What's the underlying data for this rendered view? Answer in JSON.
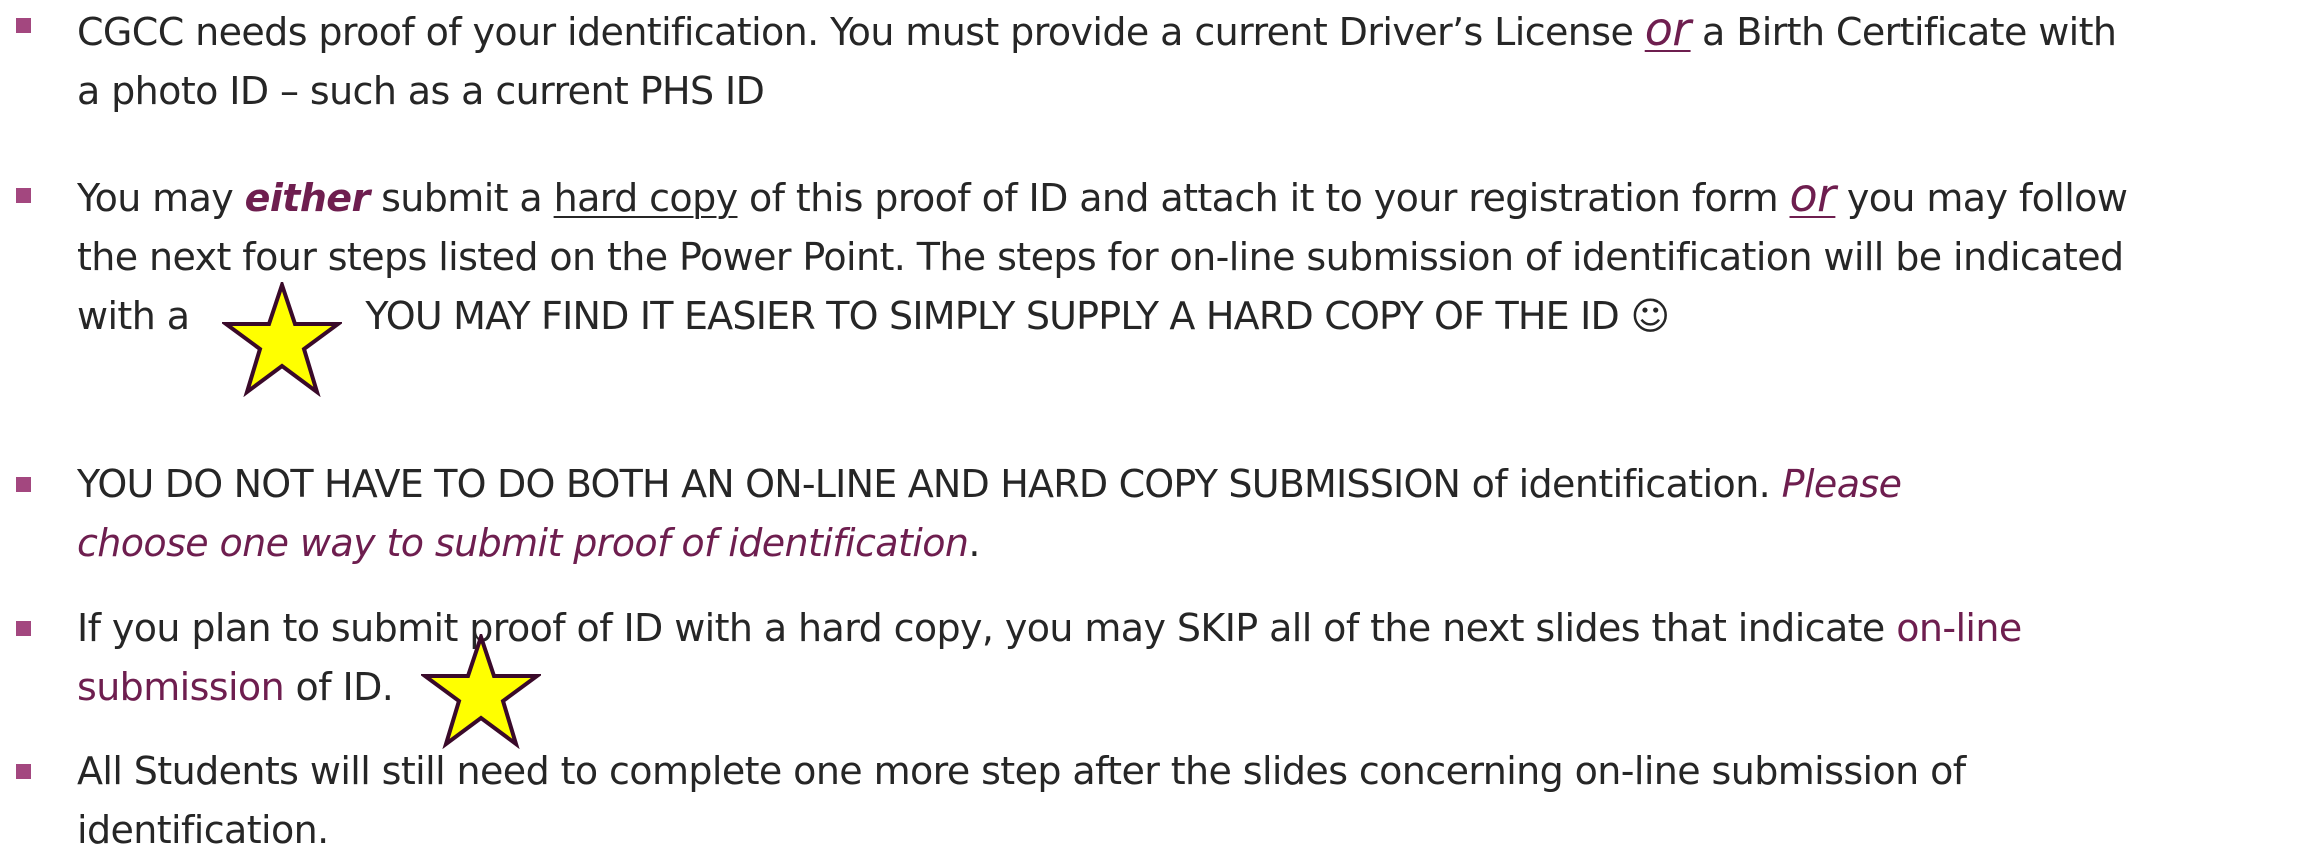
{
  "colors": {
    "text": "#262626",
    "accent": "#6e1e4f",
    "bullet": "#a3477f",
    "star_fill": "#ffff00",
    "star_stroke": "#3a0a2a"
  },
  "bullets": [
    {
      "part1": "CGCC needs proof of your identification. You must provide a current Driver’s License ",
      "or": "or",
      "part2": " a Birth Certificate with",
      "line2": "a photo ID – such as a current PHS ID"
    },
    {
      "you_may": "You may ",
      "either": "either",
      "submit_a": " submit a ",
      "hard_copy": "hard copy",
      "part2": " of this proof of ID and attach it to your registration form ",
      "or": "or",
      "part3": " you may follow",
      "line2": "the next four steps listed on the Power Point. The steps for on-line submission of identification will be indicated",
      "with_a": "with a",
      "caps": "YOU MAY FIND IT EASIER TO SIMPLY SUPPLY A HARD COPY OF THE ID",
      "smiley": "☺"
    },
    {
      "caps": "YOU DO NOT HAVE TO DO BOTH AN ON-LINE AND HARD COPY SUBMISSION",
      "normal": " of identification. ",
      "italic_line1": "Please",
      "italic_line2": "choose one way to submit proof of identification",
      "period": "."
    },
    {
      "part1": "If you plan to submit proof of ID with a hard copy, you may SKIP all of the next slides that indicate ",
      "accent1": "on-line",
      "accent2": "submission",
      "part2": " of ID."
    },
    {
      "line1": "All Students will still need to complete one more step after the slides concerning on-line submission of",
      "line2": "identification."
    }
  ]
}
